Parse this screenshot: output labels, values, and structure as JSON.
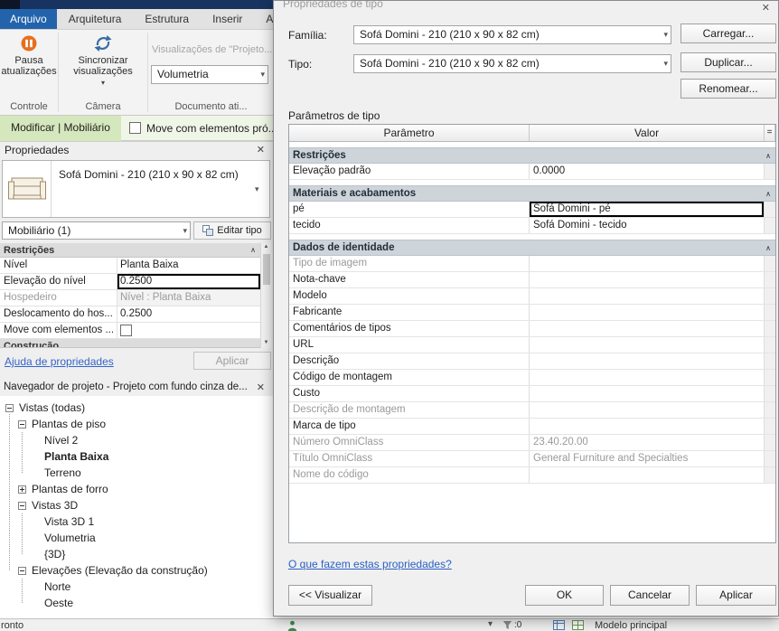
{
  "icons": {
    "close": "✕",
    "chevron_down": "▾",
    "collapse": "∧",
    "scroll_up": "▲",
    "scroll_down": "▼"
  },
  "ribbon": {
    "tabs": [
      {
        "label": "Arquivo",
        "active": true
      },
      {
        "label": "Arquitetura",
        "active": false
      },
      {
        "label": "Estrutura",
        "active": false
      },
      {
        "label": "Inserir",
        "active": false
      },
      {
        "label": "Anotar",
        "active": false
      }
    ],
    "pause_lines": [
      "Pausa",
      "atualizações"
    ],
    "sync_lines": [
      "Sincronizar",
      "visualizações"
    ],
    "gallery_label": "Visualizações de \"Projeto...",
    "view_combo_value": "Volumetria",
    "panel_labels": [
      "Controle",
      "Câmera",
      "Documento ati..."
    ]
  },
  "options_bar": {
    "mode_label": "Modificar | Mobiliário",
    "checkbox_label": "Move com elementos pró..."
  },
  "properties_palette": {
    "title": "Propriedades",
    "type_name": "Sofá Domini - 210 (210 x 90 x 82 cm)",
    "selector_value": "Mobiliário (1)",
    "edit_type_label": "Editar tipo",
    "section_header": "Restrições",
    "rows": [
      {
        "label": "Nível",
        "value": "Planta Baixa",
        "style": "normal"
      },
      {
        "label": "Elevação do nível",
        "value": "0.2500",
        "style": "editing"
      },
      {
        "label": "Hospedeiro",
        "value": "Nível : Planta Baixa",
        "style": "gray"
      },
      {
        "label": "Deslocamento do hos...",
        "value": "0.2500",
        "style": "normal"
      },
      {
        "label": "Move com elementos ...",
        "value": "",
        "style": "checkbox"
      }
    ],
    "clipped_section": "Construção",
    "help_link": "Ajuda de propriedades",
    "apply_label": "Aplicar"
  },
  "project_browser": {
    "title": "Navegador de projeto - Projeto com fundo cinza de...",
    "tree": [
      {
        "label": "Vistas (todas)",
        "level": 0,
        "expander": "minus",
        "bold": false
      },
      {
        "label": "Plantas de piso",
        "level": 1,
        "expander": "minus",
        "bold": false
      },
      {
        "label": "Nível 2",
        "level": 2,
        "expander": "none",
        "bold": false
      },
      {
        "label": "Planta Baixa",
        "level": 2,
        "expander": "none",
        "bold": true
      },
      {
        "label": "Terreno",
        "level": 2,
        "expander": "none",
        "bold": false
      },
      {
        "label": "Plantas de forro",
        "level": 1,
        "expander": "plus",
        "bold": false
      },
      {
        "label": "Vistas 3D",
        "level": 1,
        "expander": "minus",
        "bold": false
      },
      {
        "label": "Vista 3D 1",
        "level": 2,
        "expander": "none",
        "bold": false
      },
      {
        "label": "Volumetria",
        "level": 2,
        "expander": "none",
        "bold": false
      },
      {
        "label": "{3D}",
        "level": 2,
        "expander": "none",
        "bold": false
      },
      {
        "label": "Elevações (Elevação da construção)",
        "level": 1,
        "expander": "minus",
        "bold": false
      },
      {
        "label": "Norte",
        "level": 2,
        "expander": "none",
        "bold": false
      },
      {
        "label": "Oeste",
        "level": 2,
        "expander": "none",
        "bold": false
      }
    ]
  },
  "type_dialog": {
    "title": "Propriedades de tipo",
    "family_label": "Família:",
    "family_value": "Sofá Domini - 210 (210 x 90 x 82 cm)",
    "type_label": "Tipo:",
    "type_value": "Sofá Domini - 210 (210 x 90 x 82 cm)",
    "load_button": "Carregar...",
    "duplicate_button": "Duplicar...",
    "rename_button": "Renomear...",
    "parameters_label": "Parâmetros de tipo",
    "col_param": "Parâmetro",
    "col_value": "Valor",
    "col_eq": "=",
    "groups": [
      {
        "name": "Restrições",
        "rows": [
          {
            "param": "Elevação padrão",
            "value": "0.0000",
            "style": "normal"
          }
        ]
      },
      {
        "name": "Materiais e acabamentos",
        "rows": [
          {
            "param": "pé",
            "value": "Sofá Domini - pé",
            "style": "selected"
          },
          {
            "param": "tecido",
            "value": "Sofá Domini - tecido",
            "style": "normal"
          }
        ]
      },
      {
        "name": "Dados de identidade",
        "rows": [
          {
            "param": "Tipo de imagem",
            "value": "",
            "style": "gray"
          },
          {
            "param": "Nota-chave",
            "value": "",
            "style": "normal"
          },
          {
            "param": "Modelo",
            "value": "",
            "style": "normal"
          },
          {
            "param": "Fabricante",
            "value": "",
            "style": "normal"
          },
          {
            "param": "Comentários de tipos",
            "value": "",
            "style": "normal"
          },
          {
            "param": "URL",
            "value": "",
            "style": "normal"
          },
          {
            "param": "Descrição",
            "value": "",
            "style": "normal"
          },
          {
            "param": "Código de montagem",
            "value": "",
            "style": "normal"
          },
          {
            "param": "Custo",
            "value": "",
            "style": "normal"
          },
          {
            "param": "Descrição de montagem",
            "value": "",
            "style": "gray"
          },
          {
            "param": "Marca de tipo",
            "value": "",
            "style": "normal"
          },
          {
            "param": "Número OmniClass",
            "value": "23.40.20.00",
            "style": "gray"
          },
          {
            "param": "Título OmniClass",
            "value": "General Furniture and Specialties",
            "style": "gray"
          },
          {
            "param": "Nome do código",
            "value": "",
            "style": "gray"
          }
        ]
      }
    ],
    "help_link": "O que fazem estas propriedades?",
    "preview_button": "<< Visualizar",
    "ok_button": "OK",
    "cancel_button": "Cancelar",
    "apply_button": "Aplicar"
  },
  "status_bar": {
    "left_text": "ronto",
    "filter_count": ":0",
    "model_label": "Modelo principal"
  }
}
